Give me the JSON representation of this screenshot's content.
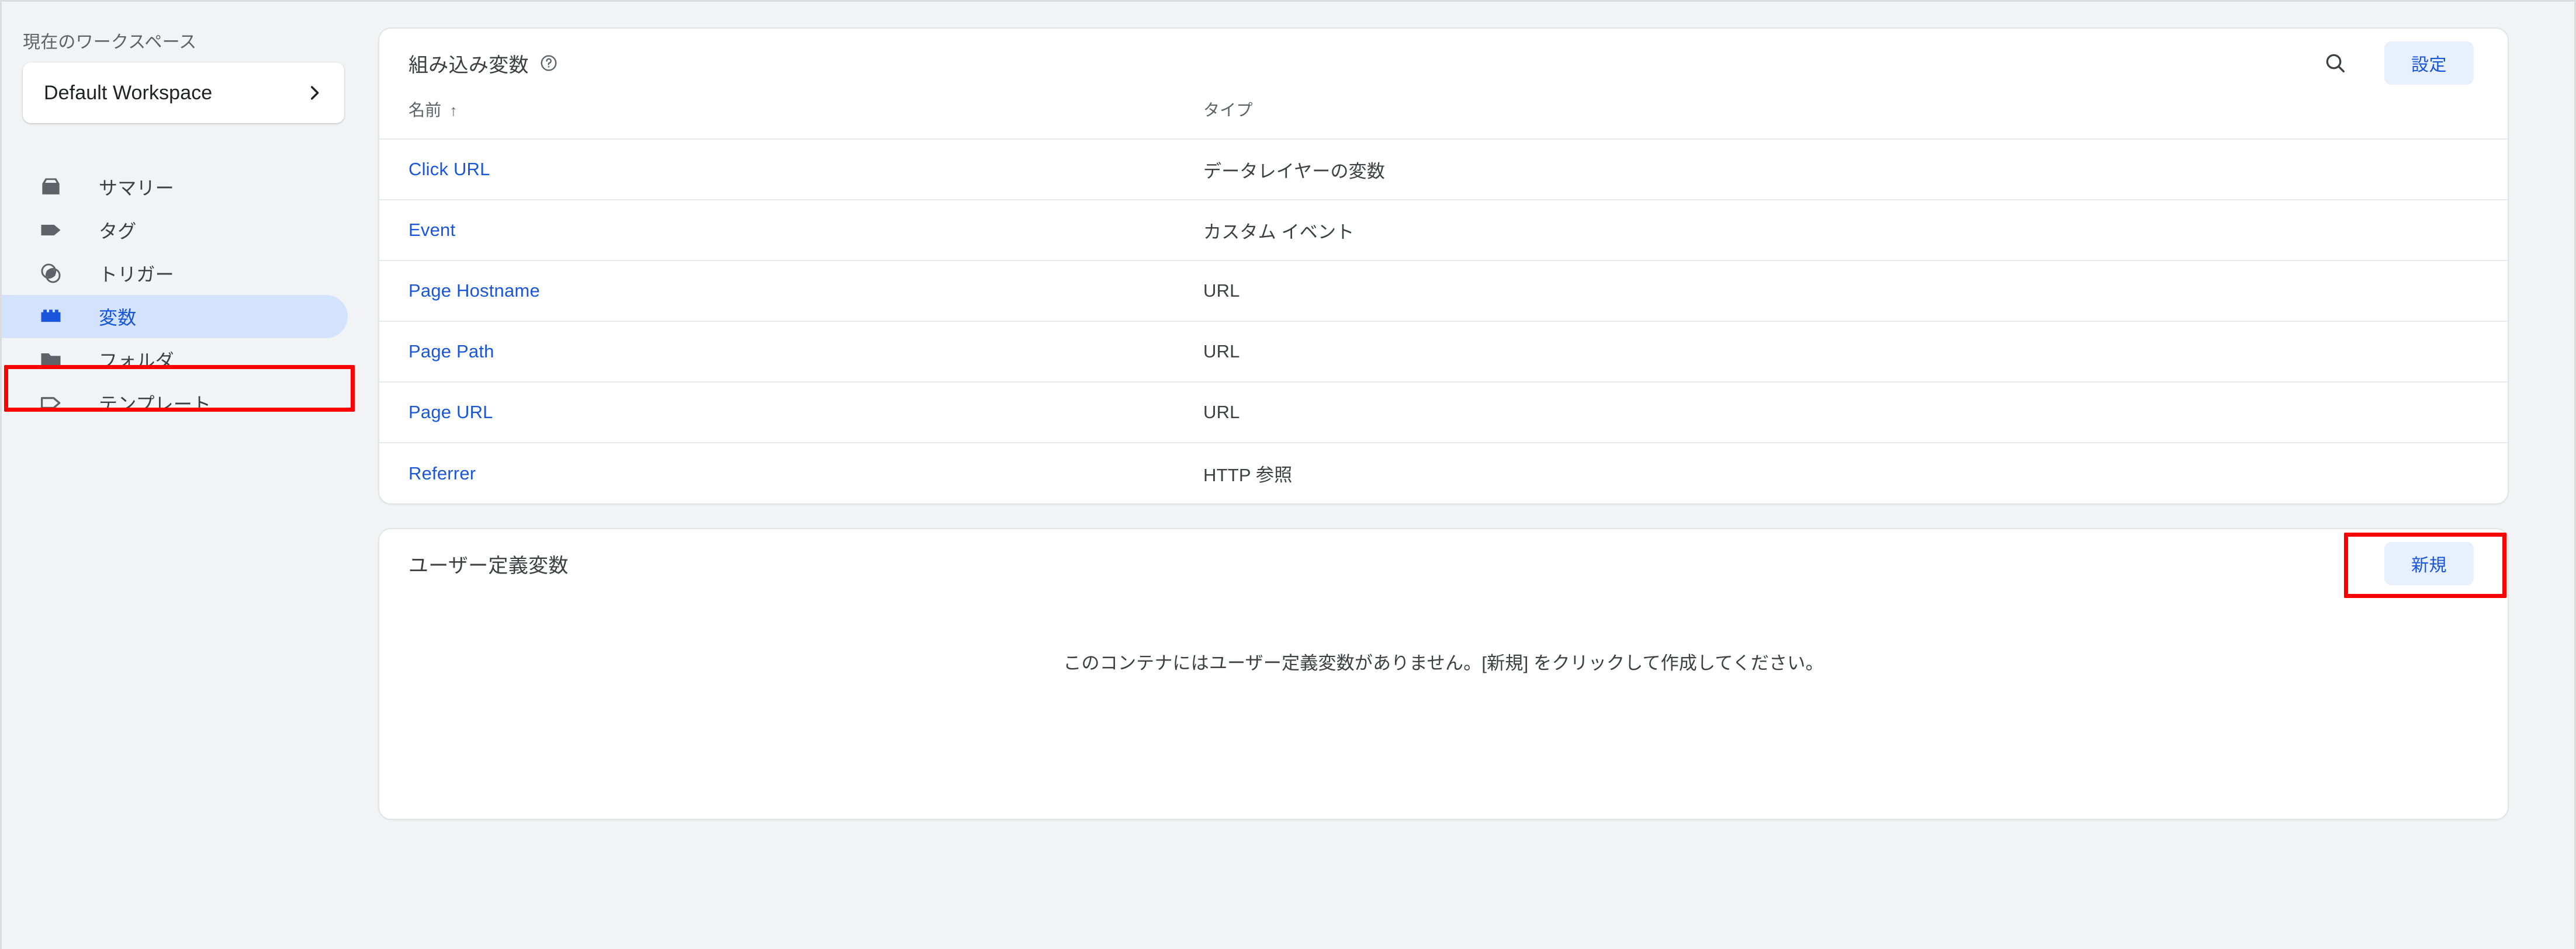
{
  "sidebar": {
    "workspace_label": "現在のワークスペース",
    "workspace_name": "Default Workspace",
    "chevron_icon": "chevron-right-icon",
    "items": [
      {
        "label": "サマリー",
        "icon": "inbox-icon",
        "active": false
      },
      {
        "label": "タグ",
        "icon": "tag-icon",
        "active": false
      },
      {
        "label": "トリガー",
        "icon": "trigger-icon",
        "active": false
      },
      {
        "label": "変数",
        "icon": "variable-brick-icon",
        "active": true
      },
      {
        "label": "フォルダ",
        "icon": "folder-icon",
        "active": false
      },
      {
        "label": "テンプレート",
        "icon": "template-tag-outline-icon",
        "active": false
      }
    ]
  },
  "builtin_card": {
    "title": "組み込み変数",
    "help_icon": "help-circle-icon",
    "search_icon": "search-icon",
    "configure_label": "設定",
    "columns": {
      "name": "名前",
      "type": "タイプ"
    },
    "sort_arrow": "↑",
    "rows": [
      {
        "name": "Click URL",
        "type": "データレイヤーの変数"
      },
      {
        "name": "Event",
        "type": "カスタム イベント"
      },
      {
        "name": "Page Hostname",
        "type": "URL"
      },
      {
        "name": "Page Path",
        "type": "URL"
      },
      {
        "name": "Page URL",
        "type": "URL"
      },
      {
        "name": "Referrer",
        "type": "HTTP 参照"
      }
    ]
  },
  "userdef_card": {
    "title": "ユーザー定義変数",
    "new_label": "新規",
    "empty_message": "このコンテナにはユーザー定義変数がありません。[新規] をクリックして作成してください。"
  },
  "colors": {
    "accent": "#1a56db",
    "tonal_button_bg": "#e8f0fe",
    "active_nav_bg": "#d3e3fd",
    "annotation": "#ff0000",
    "page_bg": "#f1f3f4"
  }
}
